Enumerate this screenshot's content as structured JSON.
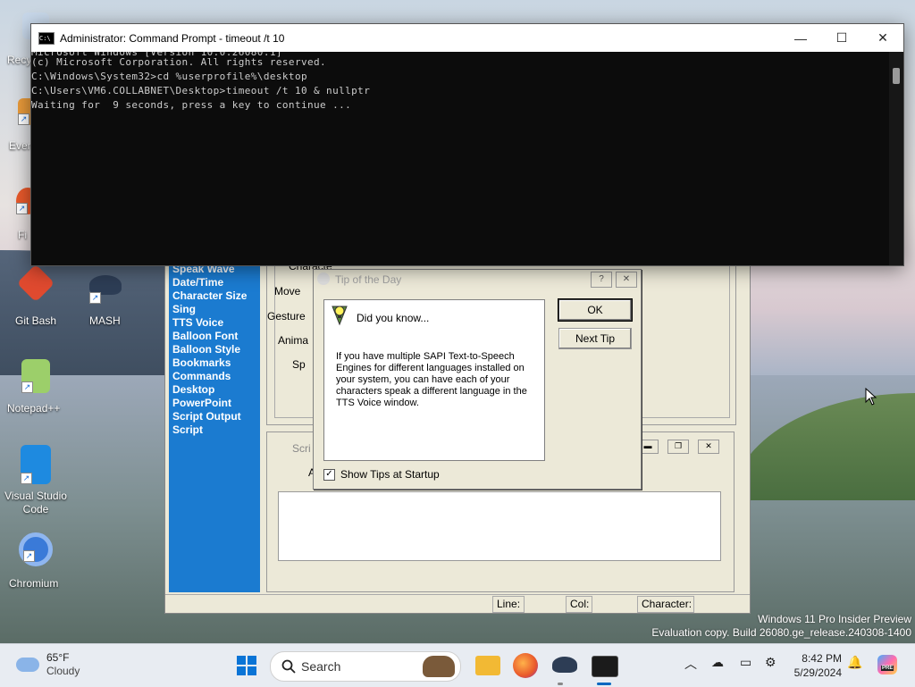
{
  "desktop": {
    "icons": [
      {
        "label": "Recy"
      },
      {
        "label": "Ever"
      },
      {
        "label": "Fi"
      },
      {
        "label": "Git Bash"
      },
      {
        "label": "MASH"
      },
      {
        "label": "Notepad++"
      },
      {
        "label": "Visual Studio Code"
      },
      {
        "label": "Chromium"
      }
    ],
    "watermark": {
      "line1": "Windows 11 Pro Insider Preview",
      "line2": "Evaluation copy. Build 26080.ge_release.240308-1400"
    }
  },
  "cmd": {
    "title": "Administrator: Command Prompt - timeout  /t 10",
    "lines": [
      "Microsoft Windows [Version 10.0.26080.1]",
      "(c) Microsoft Corporation. All rights reserved.",
      "",
      "C:\\Windows\\System32>cd %userprofile%\\desktop",
      "",
      "C:\\Users\\VM6.COLLABNET\\Desktop>timeout /t 10 & nullptr",
      "",
      "Waiting for  9 seconds, press a key to continue ..."
    ]
  },
  "mash": {
    "sidebar": [
      "Speak Wave",
      "Date/Time",
      "Character Size",
      "Sing",
      "TTS Voice",
      "Balloon Font",
      "Balloon Style",
      "Bookmarks",
      "Commands",
      "Desktop",
      "PowerPoint",
      "Script Output",
      "Script"
    ],
    "labels": {
      "move": "Move",
      "gesture": "Gesture",
      "anim": "Anima",
      "sp": "Sp",
      "char": "Characte",
      "script_title": "Scri",
      "a": "A"
    },
    "status": {
      "line": "Line:",
      "col": "Col:",
      "character": "Character:"
    }
  },
  "tip": {
    "title": "Tip of the Day",
    "heading": "Did you know...",
    "message": "If you have multiple SAPI Text-to-Speech Engines for different languages installed on your system, you can have each of your characters speak a different language in the TTS Voice window.",
    "ok": "OK",
    "next": "Next Tip",
    "show_tips": "Show Tips at Startup",
    "help": "?",
    "close": "✕"
  },
  "taskbar": {
    "weather_temp": "65°F",
    "weather_desc": "Cloudy",
    "search_label": "Search",
    "time": "8:42 PM",
    "date": "5/29/2024",
    "pre_badge": "PRE"
  }
}
